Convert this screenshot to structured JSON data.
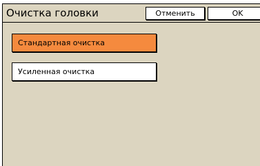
{
  "header": {
    "title": "Очистка головки",
    "cancel_label": "Отменить",
    "ok_label": "OK"
  },
  "options": [
    {
      "label": "Стандартная очистка",
      "selected": true
    },
    {
      "label": "Усиленная очистка",
      "selected": false
    }
  ],
  "colors": {
    "background": "#dcd5c0",
    "selected": "#f58a3e",
    "button": "#ffffff"
  }
}
